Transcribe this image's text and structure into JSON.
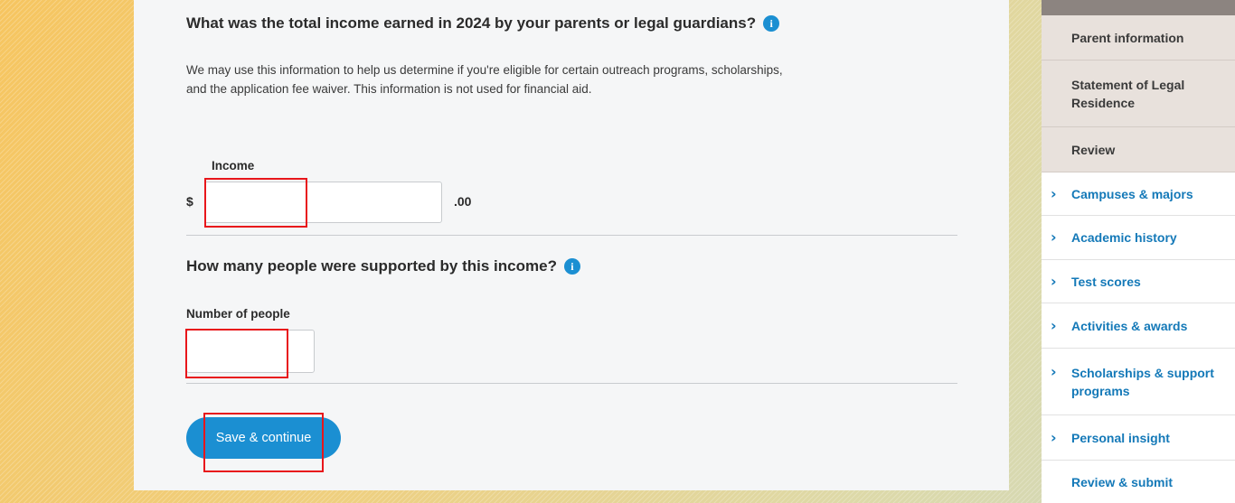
{
  "form": {
    "income_question": "What was the total income earned in 2024 by your parents or legal guardians?",
    "info_icon_glyph": "i",
    "helper_text": "We may use this information to help us determine if you're eligible for certain outreach programs, scholarships, and the application fee waiver. This information is not used for financial aid.",
    "income_label": "Income",
    "currency_symbol": "$",
    "income_value": "",
    "cents_suffix": ".00",
    "people_question": "How many people were supported by this income?",
    "people_label": "Number of people",
    "people_value": "",
    "save_label": "Save & continue"
  },
  "sidebar": {
    "sub_items": [
      {
        "label": "Parent information"
      },
      {
        "label": "Statement of Legal Residence"
      },
      {
        "label": "Review"
      }
    ],
    "items": [
      {
        "label": "Campuses & majors",
        "icon": "chevron-right-icon"
      },
      {
        "label": "Academic history",
        "icon": "chevron-right-icon"
      },
      {
        "label": "Test scores",
        "icon": "chevron-right-icon"
      },
      {
        "label": "Activities & awards",
        "icon": "chevron-right-icon"
      },
      {
        "label": "Scholarships & support programs",
        "icon": "chevron-right-icon"
      },
      {
        "label": "Personal insight",
        "icon": "chevron-right-icon"
      },
      {
        "label": "Review & submit",
        "icon": ""
      }
    ],
    "chevron_glyph": "›"
  },
  "colors": {
    "accent": "#1b8fd2",
    "link": "#1479b8",
    "highlight": "#e8161b",
    "sidebar_sub_bg": "#e8e1dc"
  }
}
